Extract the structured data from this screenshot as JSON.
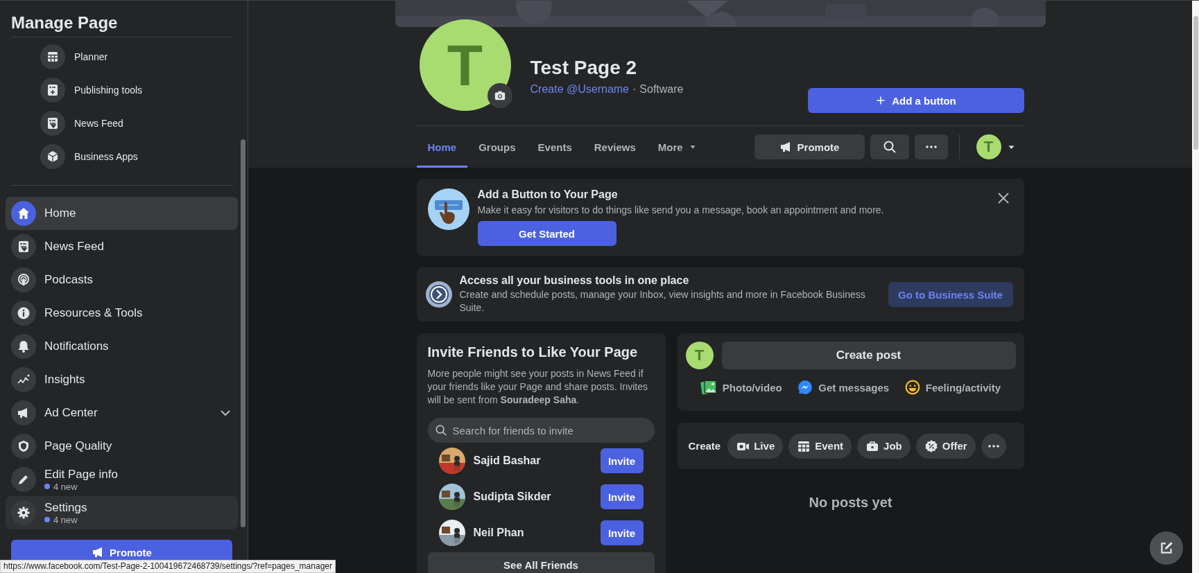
{
  "sidebar": {
    "title": "Manage Page",
    "tools": [
      {
        "label": "Planner"
      },
      {
        "label": "Publishing tools"
      },
      {
        "label": "News Feed"
      },
      {
        "label": "Business Apps"
      }
    ],
    "items": [
      {
        "label": "Home",
        "selected": true,
        "hovered": false
      },
      {
        "label": "News Feed",
        "selected": false,
        "hovered": false
      },
      {
        "label": "Podcasts",
        "selected": false,
        "hovered": false
      },
      {
        "label": "Resources & Tools",
        "selected": false,
        "hovered": false
      },
      {
        "label": "Notifications",
        "selected": false,
        "hovered": false
      },
      {
        "label": "Insights",
        "selected": false,
        "hovered": false
      },
      {
        "label": "Ad Center",
        "selected": false,
        "hovered": false,
        "expandable": true
      },
      {
        "label": "Page Quality",
        "selected": false,
        "hovered": false
      },
      {
        "label": "Edit Page info",
        "selected": false,
        "hovered": false,
        "badge": "4 new"
      },
      {
        "label": "Settings",
        "selected": false,
        "hovered": true,
        "badge": "4 new"
      }
    ],
    "promote_button": "Promote"
  },
  "page": {
    "avatar_letter": "T",
    "name": "Test Page 2",
    "username_link": "Create @Username",
    "separator": "·",
    "category": "Software",
    "add_button": "Add a button"
  },
  "tabs": [
    {
      "label": "Home",
      "selected": true,
      "dropdown": false
    },
    {
      "label": "Groups",
      "selected": false,
      "dropdown": false
    },
    {
      "label": "Events",
      "selected": false,
      "dropdown": false
    },
    {
      "label": "Reviews",
      "selected": false,
      "dropdown": false
    },
    {
      "label": "More",
      "selected": false,
      "dropdown": true
    }
  ],
  "actions": {
    "promote": "Promote",
    "profile_letter": "T"
  },
  "add_button_card": {
    "title": "Add a Button to Your Page",
    "text": "Make it easy for visitors to do things like send you a message, book an appointment and more.",
    "button": "Get Started"
  },
  "business_card": {
    "title": "Access all your business tools in one place",
    "text": "Create and schedule posts, manage your Inbox, view insights and more in Facebook Business Suite.",
    "button": "Go to Business Suite"
  },
  "invite_card": {
    "title": "Invite Friends to Like Your Page",
    "text": "More people might see your posts in News Feed if your friends like your Page and share posts. Invites will be sent from **Souradeep Saha**.",
    "search_placeholder": "Search for friends to invite",
    "friends": [
      {
        "name": "Sajid Bashar",
        "button": "Invite"
      },
      {
        "name": "Sudipta Sikder",
        "button": "Invite"
      },
      {
        "name": "Neil Phan",
        "button": "Invite"
      }
    ],
    "see_all": "See All Friends"
  },
  "composer": {
    "avatar_letter": "T",
    "create_post": "Create post",
    "actions": [
      {
        "label": "Photo/video"
      },
      {
        "label": "Get messages"
      },
      {
        "label": "Feeling/activity"
      }
    ]
  },
  "create_bar": {
    "label": "Create",
    "items": [
      {
        "label": "Live"
      },
      {
        "label": "Event"
      },
      {
        "label": "Job"
      },
      {
        "label": "Offer"
      }
    ]
  },
  "empty_state": "No posts yet",
  "status_bar": "https://www.facebook.com/Test-Page-2-100419672468739/settings/?ref=pages_manager"
}
